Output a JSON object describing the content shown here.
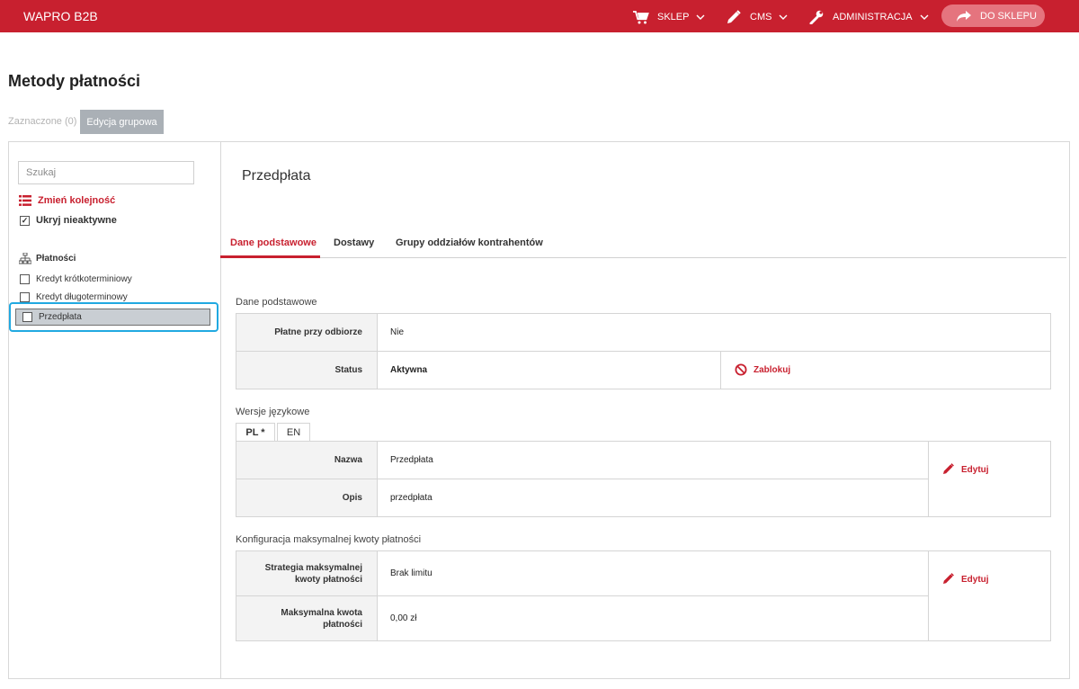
{
  "header": {
    "brand": "WAPRO B2B",
    "nav": [
      {
        "label": "SKLEP",
        "icon": "cart-icon"
      },
      {
        "label": "CMS",
        "icon": "pencil-icon"
      },
      {
        "label": "ADMINISTRACJA",
        "icon": "wrench-icon"
      }
    ],
    "shop_button": "DO SKLEPU",
    "colors": {
      "primary": "#c8202f",
      "shop_button": "#e5747e"
    }
  },
  "page": {
    "title": "Metody płatności",
    "selected_count": "Zaznaczone (0)",
    "group_edit": "Edycja grupowa"
  },
  "sidebar": {
    "search_placeholder": "Szukaj",
    "reorder_label": "Zmień kolejność",
    "hide_inactive_label": "Ukryj nieaktywne",
    "hide_inactive_checked": true,
    "tree_root": "Płatności",
    "items": [
      {
        "label": "Kredyt krótkoterminiowy",
        "selected": false
      },
      {
        "label": "Kredyt długoterminowy",
        "selected": false
      },
      {
        "label": "Przedpłata",
        "selected": true
      }
    ]
  },
  "detail": {
    "title": "Przedpłata",
    "tabs": [
      "Dane podstawowe",
      "Dostawy",
      "Grupy oddziałów kontrahentów"
    ],
    "active_tab": "Dane podstawowe",
    "basic": {
      "section_label": "Dane podstawowe",
      "rows": [
        {
          "label": "Płatne przy odbiorze",
          "value": "Nie"
        },
        {
          "label": "Status",
          "value": "Aktywna"
        }
      ],
      "block_action": "Zablokuj"
    },
    "languages": {
      "section_label": "Wersje językowe",
      "tabs": [
        "PL *",
        "EN"
      ],
      "rows": [
        {
          "label": "Nazwa",
          "value": "Przedpłata"
        },
        {
          "label": "Opis",
          "value": "przedpłata"
        }
      ],
      "edit_action": "Edytuj"
    },
    "limit": {
      "section_label": "Konfiguracja maksymalnej kwoty płatności",
      "rows": [
        {
          "label_line1": "Strategia maksymalnej",
          "label_line2": "kwoty płatności",
          "value": "Brak limitu"
        },
        {
          "label_line1": "Maksymalna kwota",
          "label_line2": "płatności",
          "value": "0,00 zł"
        }
      ],
      "edit_action": "Edytuj"
    }
  }
}
